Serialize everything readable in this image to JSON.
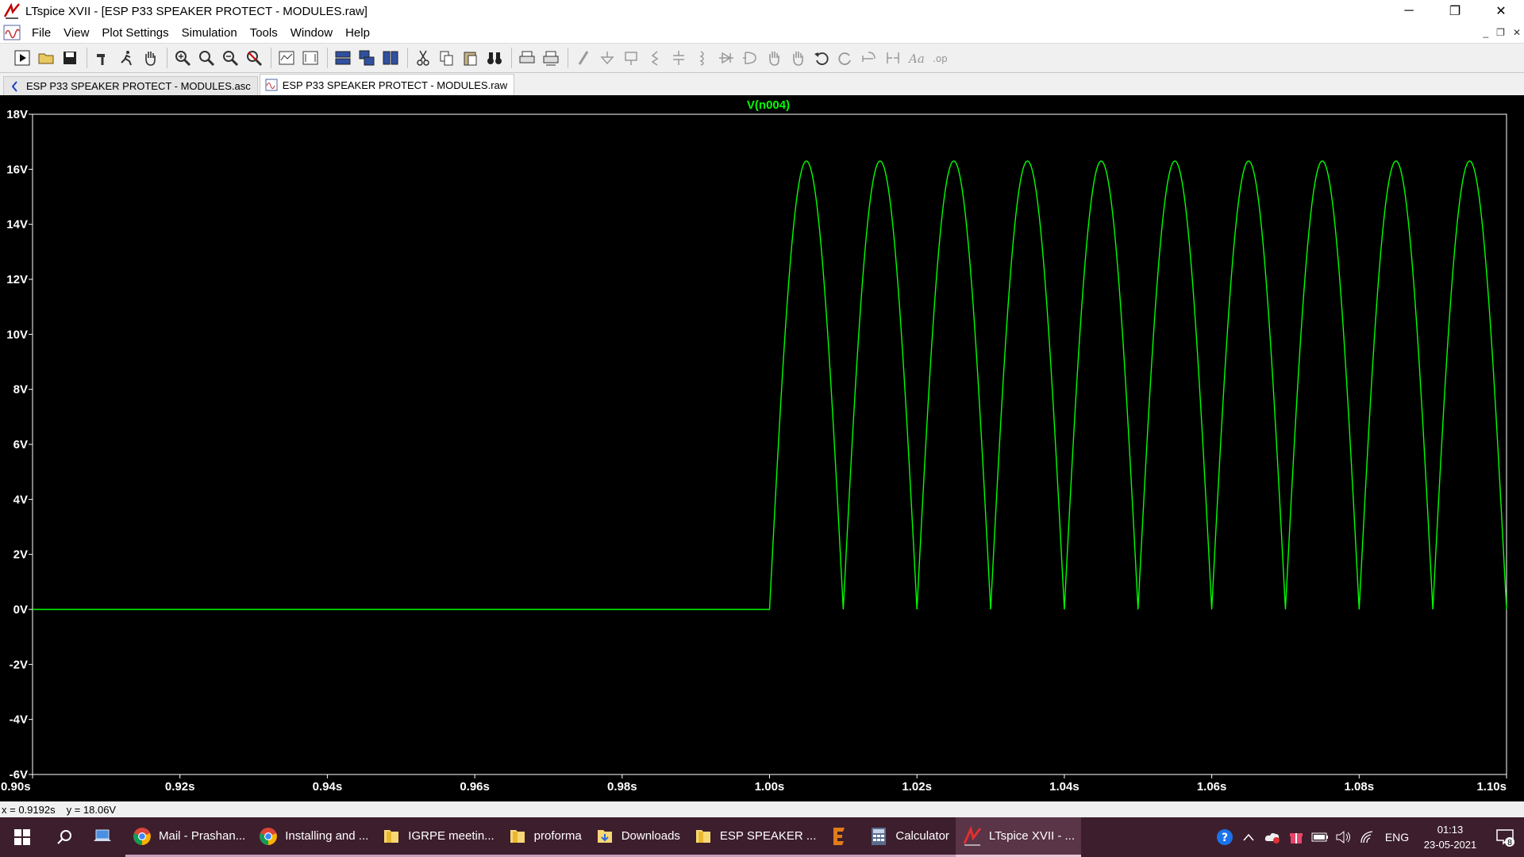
{
  "window": {
    "title": "LTspice XVII - [ESP P33 SPEAKER PROTECT - MODULES.raw]",
    "controls": {
      "minimize": "─",
      "restore": "❐",
      "close": "✕"
    }
  },
  "menu": {
    "items": [
      "File",
      "View",
      "Plot Settings",
      "Simulation",
      "Tools",
      "Window",
      "Help"
    ]
  },
  "toolbar": {
    "buttons": [
      "run",
      "open",
      "save",
      "control-panel",
      "halt",
      "pan",
      "zoom-in",
      "zoom-area",
      "zoom-out",
      "zoom-fit",
      "autorange-y",
      "zoom-full",
      "tile-horizontal",
      "cascade",
      "tile-vertical",
      "cut",
      "copy",
      "paste",
      "find",
      "print",
      "print-setup",
      "draw-wire",
      "ground",
      "label-net",
      "resistor",
      "capacitor",
      "inductor",
      "diode",
      "component",
      "move",
      "drag",
      "undo",
      "redo",
      "rotate",
      "mirror",
      "text",
      "spice-directive"
    ]
  },
  "tabs": [
    {
      "label": "ESP P33 SPEAKER PROTECT - MODULES.asc",
      "icon": "schematic-icon",
      "active": false
    },
    {
      "label": "ESP P33 SPEAKER PROTECT - MODULES.raw",
      "icon": "waveform-icon",
      "active": true
    }
  ],
  "chart_data": {
    "type": "line",
    "title": "V(n004)",
    "series": [
      {
        "name": "V(n004)",
        "color": "#00ff00",
        "segments": [
          {
            "type": "flat",
            "x": [
              0.9,
              1.0
            ],
            "y": 0
          },
          {
            "type": "rectified-sine",
            "x_start": 1.0,
            "x_end": 1.1,
            "peak": 16.3,
            "period": 0.01
          }
        ],
        "peaks_x": [
          1.005,
          1.015,
          1.025,
          1.035,
          1.045,
          1.055,
          1.065,
          1.075,
          1.085,
          1.095
        ],
        "troughs_x": [
          1.01,
          1.02,
          1.03,
          1.04,
          1.05,
          1.06,
          1.07,
          1.08,
          1.09,
          1.1
        ]
      }
    ],
    "xlim": [
      0.9,
      1.1
    ],
    "ylim": [
      -6,
      18
    ],
    "x_ticks": [
      "0.90s",
      "0.92s",
      "0.94s",
      "0.96s",
      "0.98s",
      "1.00s",
      "1.02s",
      "1.04s",
      "1.06s",
      "1.08s",
      "1.10s"
    ],
    "x_tick_values": [
      0.9,
      0.92,
      0.94,
      0.96,
      0.98,
      1.0,
      1.02,
      1.04,
      1.06,
      1.08,
      1.1
    ],
    "y_ticks": [
      "18V",
      "16V",
      "14V",
      "12V",
      "10V",
      "8V",
      "6V",
      "4V",
      "2V",
      "0V",
      "-2V",
      "-4V",
      "-6V"
    ],
    "y_tick_values": [
      18,
      16,
      14,
      12,
      10,
      8,
      6,
      4,
      2,
      0,
      -2,
      -4,
      -6
    ],
    "grid": false,
    "background": "#000000",
    "axis_color": "#ffffff"
  },
  "status": {
    "x": "x = 0.9192s",
    "y": "y = 18.06V"
  },
  "taskbar": {
    "apps": [
      {
        "label": "",
        "icon": "laptop-icon",
        "state": "pinned"
      },
      {
        "label": "Mail - Prashan...",
        "icon": "chrome-icon",
        "state": "running"
      },
      {
        "label": "Installing and ...",
        "icon": "chrome-icon",
        "state": "running"
      },
      {
        "label": "IGRPE meetin...",
        "icon": "folder-icon",
        "state": "running"
      },
      {
        "label": "proforma",
        "icon": "folder-icon",
        "state": "running"
      },
      {
        "label": "Downloads",
        "icon": "folder-download-icon",
        "state": "running"
      },
      {
        "label": "ESP SPEAKER ...",
        "icon": "folder-icon",
        "state": "running"
      },
      {
        "label": "",
        "icon": "e-app-icon",
        "state": "running"
      },
      {
        "label": "Calculator",
        "icon": "calculator-icon",
        "state": "running"
      },
      {
        "label": "LTspice XVII - ...",
        "icon": "ltspice-icon",
        "state": "active"
      }
    ],
    "tray": {
      "language": "ENG",
      "time": "01:13",
      "date": "23-05-2021",
      "notifications": "8"
    }
  }
}
